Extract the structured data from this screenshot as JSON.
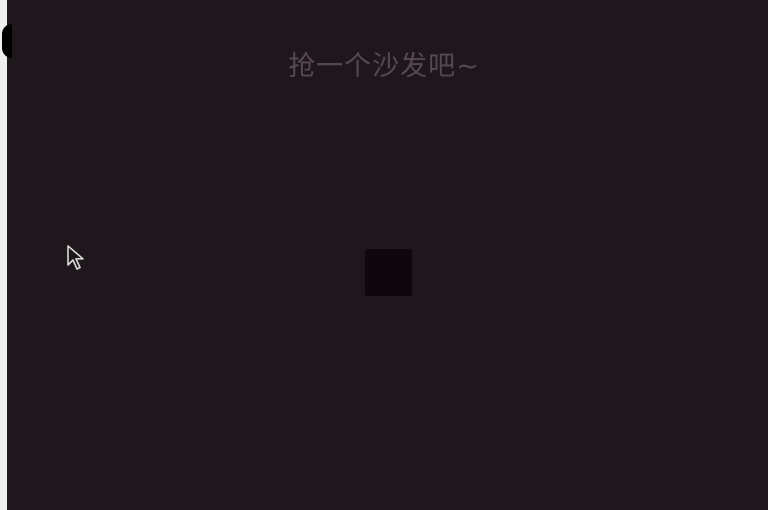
{
  "comment_panel": {
    "empty_message": "抢一个沙发吧~"
  },
  "colors": {
    "background": "#1e171b",
    "hint_text": "#55494f",
    "placeholder_square": "#0f070b"
  },
  "icons": {
    "cursor": "mouse-pointer-icon",
    "placeholder": "loading-square-icon"
  }
}
